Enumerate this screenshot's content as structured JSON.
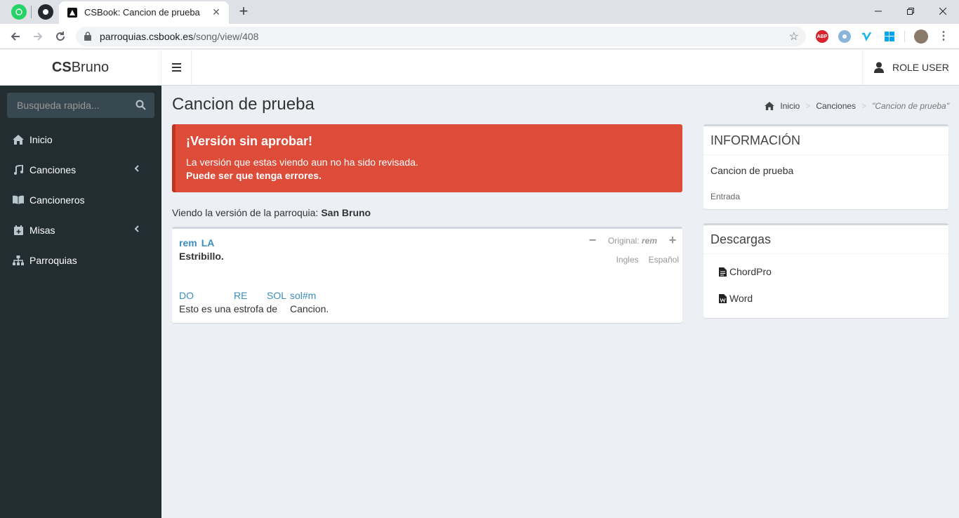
{
  "browser": {
    "tab_title": "CSBook: Cancion de prueba",
    "url_host": "parroquias.csbook.es",
    "url_path": "/song/view/408",
    "ext_abp": "ABP"
  },
  "header": {
    "logo_bold": "CS",
    "logo_rest": "Bruno",
    "user_label": "ROLE USER"
  },
  "sidebar": {
    "search_placeholder": "Busqueda rapida...",
    "items": [
      {
        "label": "Inicio",
        "icon": "home-icon"
      },
      {
        "label": "Canciones",
        "icon": "music-icon",
        "expandable": true
      },
      {
        "label": "Cancioneros",
        "icon": "book-icon"
      },
      {
        "label": "Misas",
        "icon": "calendar-icon",
        "expandable": true
      },
      {
        "label": "Parroquias",
        "icon": "sitemap-icon"
      }
    ]
  },
  "page": {
    "title": "Cancion de prueba",
    "breadcrumb": [
      "Inicio",
      "Canciones",
      "\"Cancion de prueba\""
    ]
  },
  "alert": {
    "title": "¡Versión sin aprobar!",
    "line1": "La versión que estas viendo aun no ha sido revisada.",
    "line2": "Puede ser que tenga errores."
  },
  "viewing": {
    "label": "Viendo la versión de la parroquia:",
    "parish": "San Bruno"
  },
  "song": {
    "key_chords": [
      "rem",
      "LA"
    ],
    "original_label": "Original:",
    "original_key": "rem",
    "minus": "−",
    "plus": "+",
    "languages": [
      "Ingles",
      "Español"
    ],
    "estribillo": "Estribillo.",
    "verse_chords": [
      "DO",
      "RE",
      "SOL",
      "sol#m"
    ],
    "verse_lyrics": [
      "Esto es una estrofa de",
      "Cancion."
    ]
  },
  "info": {
    "title": "INFORMACIÓN",
    "name": "Cancion de prueba",
    "type": "Entrada"
  },
  "downloads": {
    "title": "Descargas",
    "items": [
      "ChordPro",
      "Word"
    ]
  }
}
